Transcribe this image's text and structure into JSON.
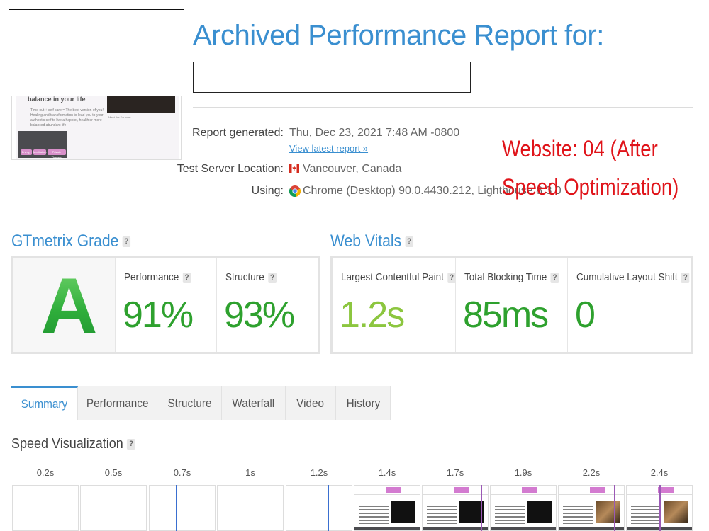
{
  "header": {
    "title": "Archived Performance Report for:"
  },
  "thumbnail": {
    "heading": "balance in your life",
    "line1": "Time out + self care = The best version of you!",
    "line2": "Healing and transformation to lead you to your authentic self to live a happier, healthier more balanced abundant life",
    "caption": "Meet the Founder",
    "buttons": [
      "Energy",
      "Meditation",
      "Private Therapy"
    ]
  },
  "report": {
    "generated_label": "Report generated:",
    "generated_value": "Thu, Dec 23, 2021 7:48 AM -0800",
    "latest_link": "View latest report »",
    "location_label": "Test Server Location:",
    "location_value": "Vancouver, Canada",
    "using_label": "Using:",
    "using_value": "Chrome (Desktop) 90.0.4430.212, Lighthouse 8.3.0"
  },
  "annotation": {
    "line1": "Website: 04 (After",
    "line2": "Speed Optimization)",
    "color": "#e0141a"
  },
  "gtmetrix": {
    "heading": "GTmetrix Grade",
    "help": "?",
    "grade": "A",
    "performance_label": "Performance",
    "performance_value": "91%",
    "structure_label": "Structure",
    "structure_value": "93%"
  },
  "web_vitals": {
    "heading": "Web Vitals",
    "help": "?",
    "lcp_label": "Largest Contentful Paint",
    "lcp_value": "1.2s",
    "tbt_label": "Total Blocking Time",
    "tbt_value": "85ms",
    "cls_label": "Cumulative Layout Shift",
    "cls_value": "0"
  },
  "colors": {
    "accent": "#3a8fd0",
    "good": "#2ea12e",
    "lcp": "#8cc63f"
  },
  "tabs": [
    {
      "label": "Summary",
      "active": true
    },
    {
      "label": "Performance",
      "active": false
    },
    {
      "label": "Structure",
      "active": false
    },
    {
      "label": "Waterfall",
      "active": false
    },
    {
      "label": "Video",
      "active": false
    },
    {
      "label": "History",
      "active": false
    }
  ],
  "speed_visualization": {
    "heading": "Speed Visualization",
    "help": "?",
    "timestamps": [
      "0.2s",
      "0.5s",
      "0.7s",
      "1s",
      "1.2s",
      "1.4s",
      "1.7s",
      "1.9s",
      "2.2s",
      "2.4s"
    ]
  }
}
